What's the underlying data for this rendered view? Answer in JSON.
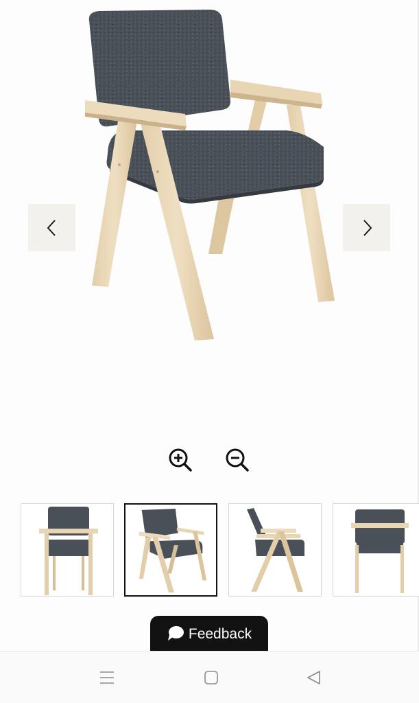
{
  "viewer": {
    "product_image": "armchair-dark-gray-upholstery-natural-wood-frame",
    "prev_icon": "chevron-left-icon",
    "next_icon": "chevron-right-icon",
    "nav_button_bg": "#f3f1ee"
  },
  "zoom": {
    "in_icon": "zoom-in-icon",
    "out_icon": "zoom-out-icon"
  },
  "thumbnails": {
    "items": [
      {
        "view": "front",
        "active": false
      },
      {
        "view": "three-quarter",
        "active": true
      },
      {
        "view": "side",
        "active": false
      },
      {
        "view": "back",
        "active": false
      }
    ]
  },
  "feedback": {
    "label": "Feedback",
    "icon": "chat-bubble-icon",
    "bg_color": "#121212"
  },
  "system_nav": {
    "menu_icon": "menu-icon",
    "home_icon": "home-square-icon",
    "back_icon": "back-triangle-icon"
  },
  "colors": {
    "upholstery": "#4a5058",
    "wood": "#ead8b6"
  }
}
